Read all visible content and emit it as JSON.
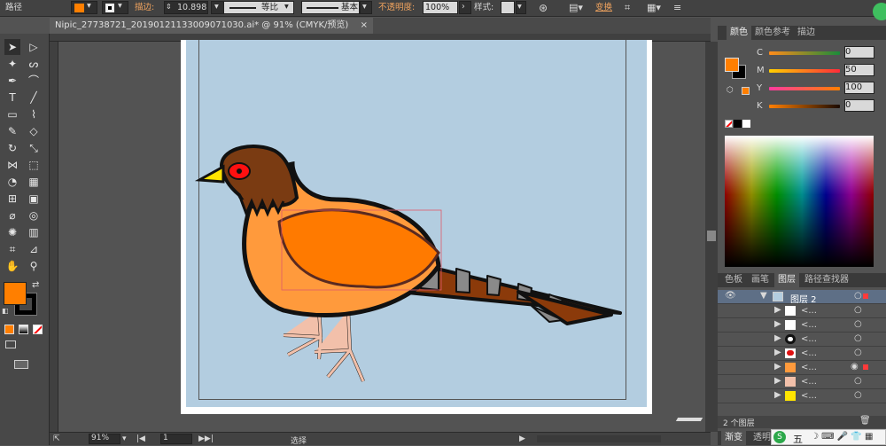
{
  "control_bar": {
    "path_label": "路径",
    "stroke_label": "描边:",
    "stroke_value": "10.898",
    "profile_label": "等比",
    "brush_label": "基本",
    "opacity_label": "不透明度:",
    "opacity_value": "100%",
    "style_label": "样式:",
    "transform_label": "变换"
  },
  "document": {
    "tab_title": "Nipic_27738721_20190121133009071030.ai* @ 91% (CMYK/预览)",
    "close_glyph": "×"
  },
  "status_bar": {
    "zoom": "91%",
    "page": "1",
    "tool": "选择"
  },
  "color_panel": {
    "tabs": [
      "颜色",
      "颜色参考",
      "描边"
    ],
    "channels": [
      {
        "key": "C",
        "value": "0"
      },
      {
        "key": "M",
        "value": "50"
      },
      {
        "key": "Y",
        "value": "100"
      },
      {
        "key": "K",
        "value": "0"
      }
    ]
  },
  "layers_panel": {
    "tabs": [
      "色板",
      "画笔",
      "图层",
      "路径查找器"
    ],
    "top_layer": "图层 2",
    "sublayer_label": "<...",
    "count": "2 个图层"
  },
  "bottom_panel": {
    "tabs": [
      "渐变",
      "透明"
    ]
  },
  "colors": {
    "fill": "#ff7f00",
    "artboard_bg": "#b3cde0",
    "bird_body": "#ff9a3c",
    "wing": "#ff7a00",
    "head": "#7a3b12",
    "beak": "#ffe400",
    "eye": "#ff1010",
    "legs": "#f2c0aa",
    "tail_gray": "#8a8a8a",
    "tail_brown": "#8b3a0a"
  },
  "ime_bar": {
    "label": "五"
  }
}
